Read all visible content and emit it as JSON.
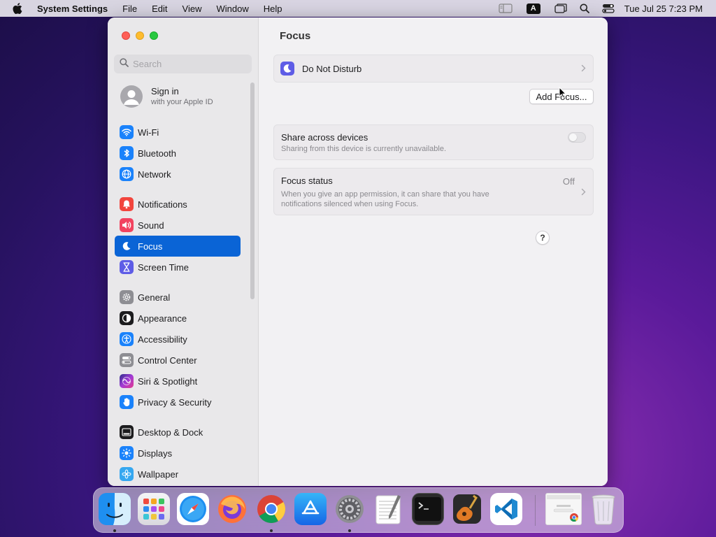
{
  "menubar": {
    "app_name": "System Settings",
    "menus": [
      "File",
      "Edit",
      "View",
      "Window",
      "Help"
    ],
    "input_source": "A",
    "clock": "Tue Jul 25  7:23 PM"
  },
  "sidebar": {
    "search_placeholder": "Search",
    "signin_title": "Sign in",
    "signin_subtitle": "with your Apple ID",
    "items": [
      {
        "label": "Wi-Fi",
        "icon": "wifi-icon",
        "color": "#1a82fb"
      },
      {
        "label": "Bluetooth",
        "icon": "bluetooth-icon",
        "color": "#1a82fb"
      },
      {
        "label": "Network",
        "icon": "globe-icon",
        "color": "#1a82fb"
      },
      {
        "label": "Notifications",
        "icon": "bell-icon",
        "color": "#f2453d"
      },
      {
        "label": "Sound",
        "icon": "speaker-icon",
        "color": "#f2435f"
      },
      {
        "label": "Focus",
        "icon": "moon-icon",
        "color": "#5e5ce6"
      },
      {
        "label": "Screen Time",
        "icon": "hourglass-icon",
        "color": "#5e5ce6"
      },
      {
        "label": "General",
        "icon": "gear-icon",
        "color": "#8e8e93"
      },
      {
        "label": "Appearance",
        "icon": "appearance-icon",
        "color": "#1c1c1e"
      },
      {
        "label": "Accessibility",
        "icon": "accessibility-icon",
        "color": "#1a82fb"
      },
      {
        "label": "Control Center",
        "icon": "control-center-icon",
        "color": "#8e8e93"
      },
      {
        "label": "Siri & Spotlight",
        "icon": "siri-icon",
        "color": "#a23bd6"
      },
      {
        "label": "Privacy & Security",
        "icon": "hand-icon",
        "color": "#1a82fb"
      },
      {
        "label": "Desktop & Dock",
        "icon": "dock-icon",
        "color": "#1c1c1e"
      },
      {
        "label": "Displays",
        "icon": "sun-icon",
        "color": "#1a82fb"
      },
      {
        "label": "Wallpaper",
        "icon": "flower-icon",
        "color": "#35a7f0"
      }
    ],
    "selected": "Focus"
  },
  "content": {
    "title": "Focus",
    "dnd_label": "Do Not Disturb",
    "add_focus_label": "Add Focus...",
    "share": {
      "title": "Share across devices",
      "subtitle": "Sharing from this device is currently unavailable.",
      "enabled": false
    },
    "status": {
      "title": "Focus status",
      "value": "Off",
      "description": "When you give an app permission, it can share that you have notifications silenced when using Focus."
    },
    "help_label": "?"
  },
  "dock": {
    "apps": [
      "Finder",
      "Launchpad",
      "Safari",
      "Firefox",
      "Chrome",
      "App Store",
      "System Settings",
      "TextEdit",
      "Terminal",
      "GarageBand",
      "Visual Studio Code",
      "Chrome Window",
      "Trash"
    ]
  }
}
